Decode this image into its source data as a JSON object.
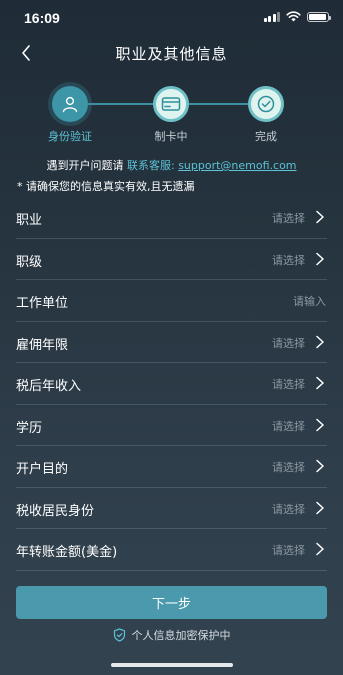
{
  "status_bar": {
    "time": "16:09"
  },
  "nav": {
    "title": "职业及其他信息"
  },
  "steps": [
    {
      "label": "身份验证",
      "state": "active",
      "icon": "user-icon"
    },
    {
      "label": "制卡中",
      "state": "pending",
      "icon": "card-icon"
    },
    {
      "label": "完成",
      "state": "pending",
      "icon": "check-icon"
    }
  ],
  "contact": {
    "prefix": "遇到开户问题请",
    "service_label": "联系客服:",
    "email": "support@nemofi.com"
  },
  "notice": "* 请确保您的信息真实有效,且无遗漏",
  "form": {
    "rows": [
      {
        "label": "职业",
        "placeholder": "请选择"
      },
      {
        "label": "职级",
        "placeholder": "请选择"
      },
      {
        "label": "工作单位",
        "placeholder": "请输入"
      },
      {
        "label": "雇佣年限",
        "placeholder": "请选择"
      },
      {
        "label": "税后年收入",
        "placeholder": "请选择"
      },
      {
        "label": "学历",
        "placeholder": "请选择"
      },
      {
        "label": "开户目的",
        "placeholder": "请选择"
      },
      {
        "label": "税收居民身份",
        "placeholder": "请选择"
      },
      {
        "label": "年转账金额(美金)",
        "placeholder": "请选择"
      }
    ]
  },
  "next_button": "下一步",
  "privacy": "个人信息加密保护中",
  "colors": {
    "accent": "#5cc2d4",
    "button": "#4a99ad",
    "background": "#26343f"
  }
}
